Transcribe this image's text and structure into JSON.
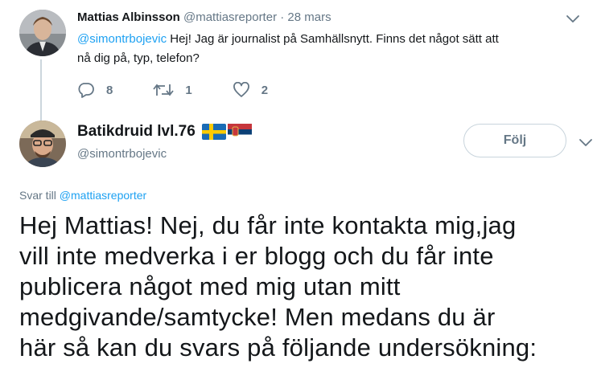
{
  "reply_tweet": {
    "display_name": "Mattias Albinsson",
    "handle": "@mattiasreporter",
    "separator": "·",
    "date": "28 mars",
    "mention": "@simontrbojevic",
    "text_line1": " Hej! Jag är journalist på Samhällsnytt. Finns det något sätt att",
    "text_line2": "nå dig på, typ, telefon?",
    "reply_count": "8",
    "retweet_count": "1",
    "like_count": "2"
  },
  "main_tweet": {
    "display_name": "Batikdruid lvl.76",
    "handle": "@simontrbojevic",
    "follow_label": "Följ",
    "reply_to_prefix": "Svar till",
    "reply_to_handle": "@mattiasreporter",
    "body_lines": [
      "Hej Mattias! Nej, du får inte kontakta mig,jag",
      "vill inte medverka i er blogg och du får inte",
      "publicera något med mig utan mitt",
      "medgivande/samtycke! Men medans du är",
      "här så kan du svars på följande undersökning:"
    ]
  },
  "colors": {
    "link": "#1da1f2",
    "muted": "#657786",
    "text": "#14171a",
    "thread_line": "#ccd6dd"
  },
  "icons": {
    "reply": "reply-icon",
    "retweet": "retweet-icon",
    "like": "heart-icon",
    "menu": "chevron-down-icon",
    "flag_se": "flag-sweden-icon",
    "flag_rs": "flag-serbia-icon"
  }
}
